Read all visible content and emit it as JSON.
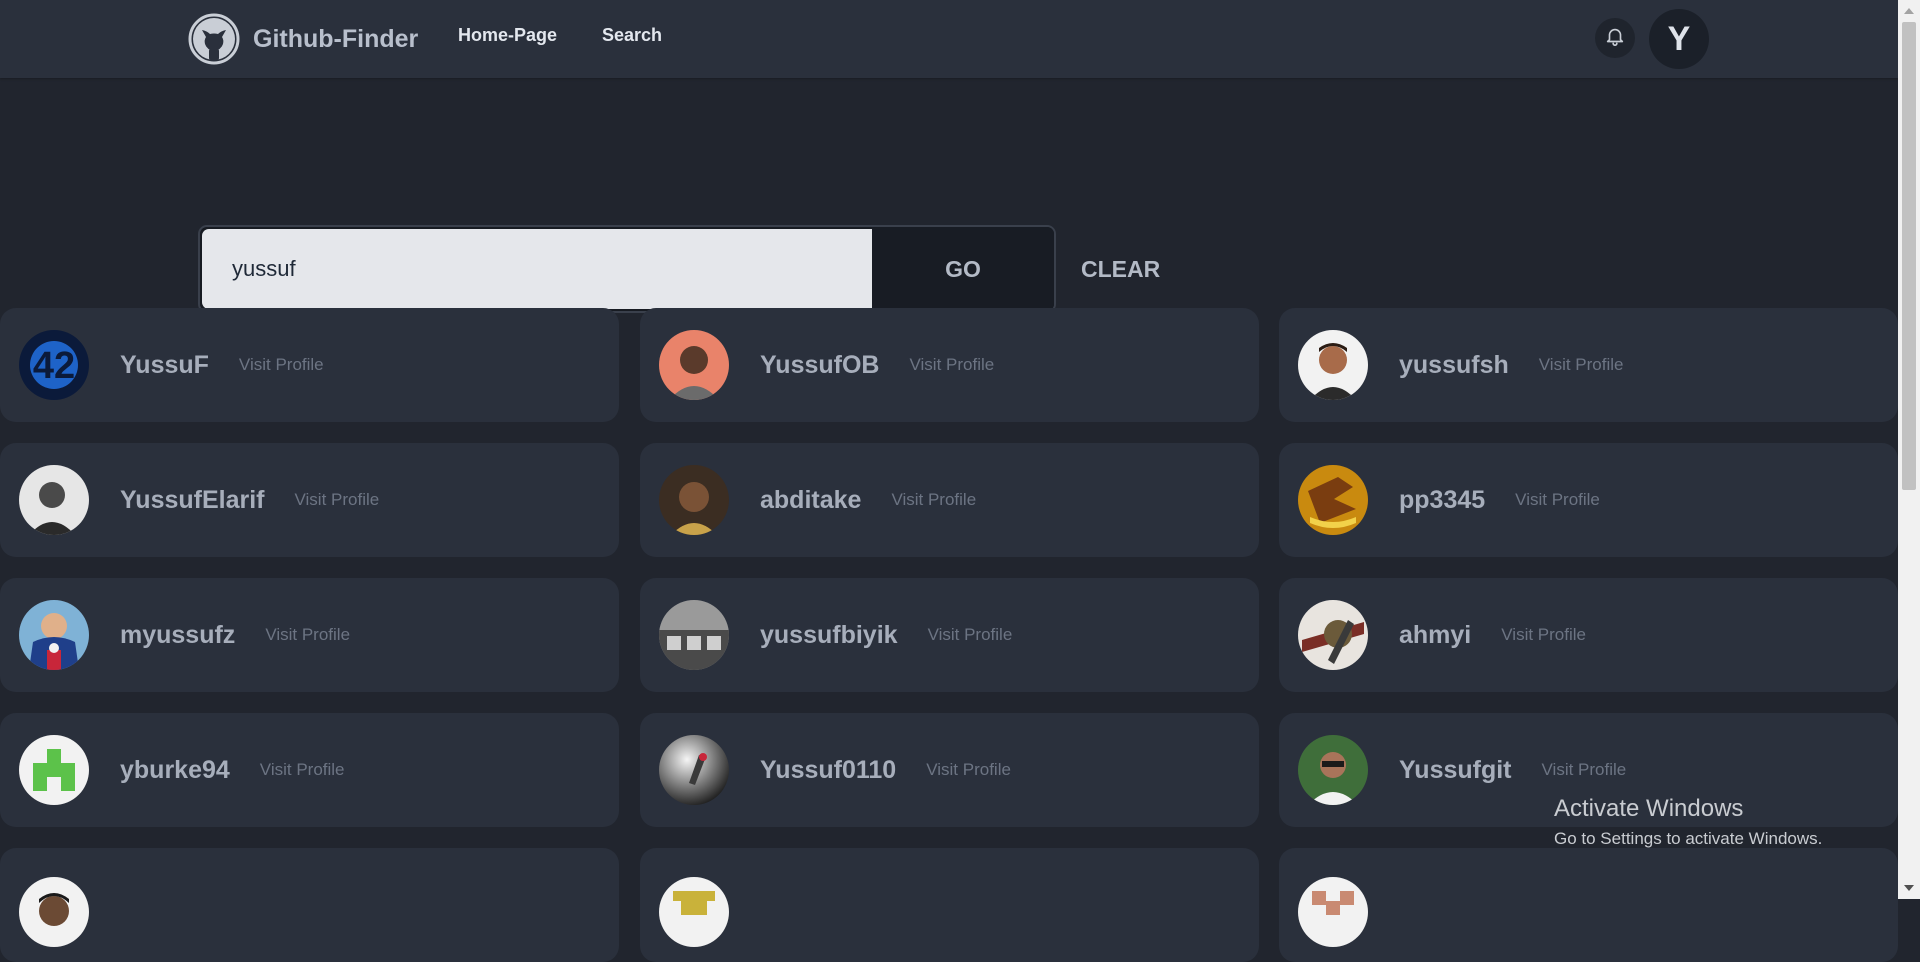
{
  "navbar": {
    "brand": "Github-Finder",
    "links": [
      "Home-Page",
      "Search"
    ],
    "avatar_letter": "Y",
    "icons": {
      "logo": "github-octocat-icon",
      "bell": "bell-icon"
    }
  },
  "search": {
    "value": "yussuf",
    "go_label": "GO",
    "clear_label": "CLEAR"
  },
  "users": [
    {
      "login": "YussuF",
      "link": "Visit Profile"
    },
    {
      "login": "YussufOB",
      "link": "Visit Profile"
    },
    {
      "login": "yussufsh",
      "link": "Visit Profile"
    },
    {
      "login": "YussufElarif",
      "link": "Visit Profile"
    },
    {
      "login": "abditake",
      "link": "Visit Profile"
    },
    {
      "login": "pp3345",
      "link": "Visit Profile"
    },
    {
      "login": "myussufz",
      "link": "Visit Profile"
    },
    {
      "login": "yussufbiyik",
      "link": "Visit Profile"
    },
    {
      "login": "ahmyi",
      "link": "Visit Profile"
    },
    {
      "login": "yburke94",
      "link": "Visit Profile"
    },
    {
      "login": "Yussuf0110",
      "link": "Visit Profile"
    },
    {
      "login": "Yussufgit",
      "link": "Visit Profile"
    }
  ],
  "windows_watermark": {
    "title": "Activate Windows",
    "subtitle": "Go to Settings to activate Windows."
  },
  "colors": {
    "page_bg": "#21252e",
    "navbar_bg": "#2a303c",
    "card_bg": "#2a303c",
    "go_bg": "#181c24",
    "input_bg": "#e5e7eb"
  }
}
